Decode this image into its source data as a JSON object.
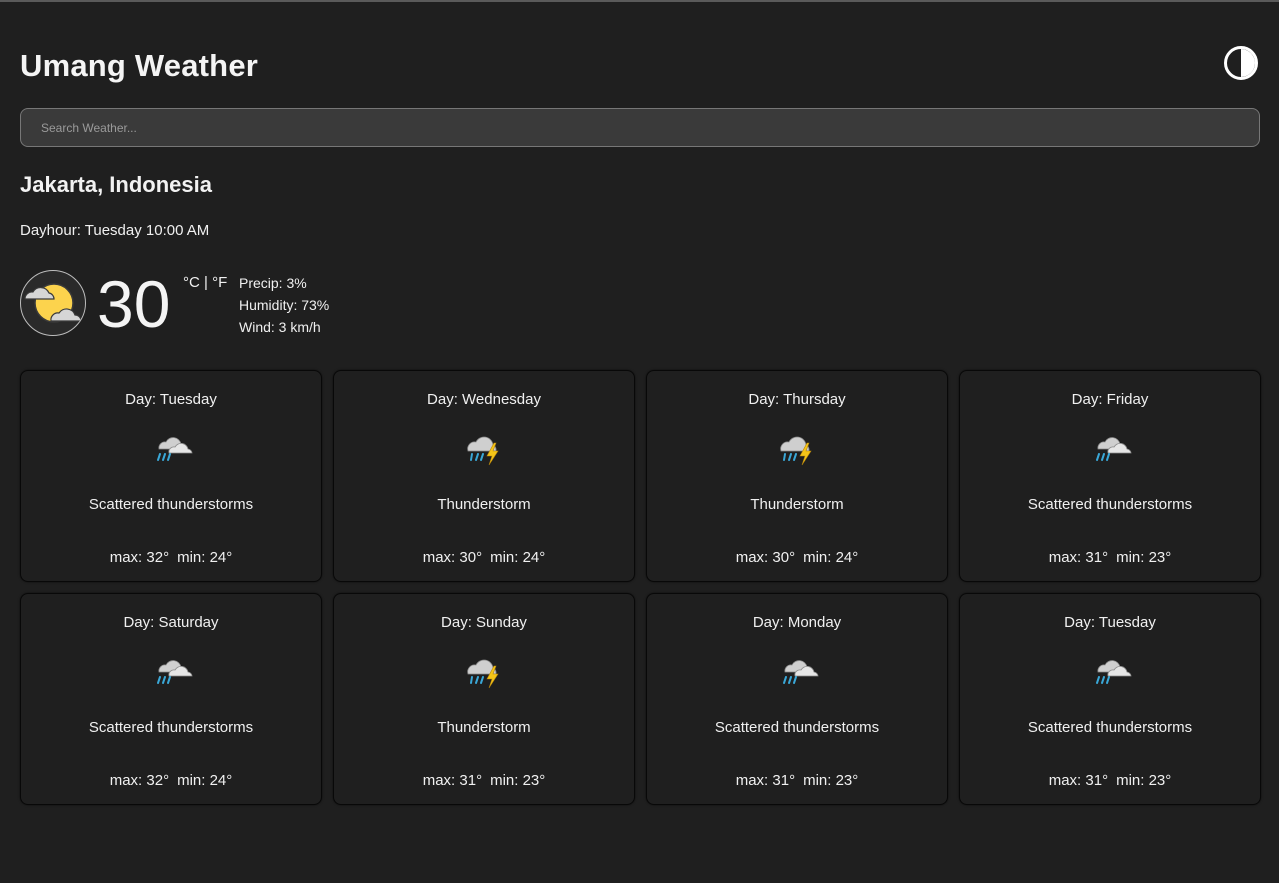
{
  "app": {
    "title": "Umang Weather"
  },
  "search": {
    "placeholder": "Search Weather..."
  },
  "location": "Jakarta, Indonesia",
  "dayhour": "Dayhour: Tuesday 10:00 AM",
  "current": {
    "icon": "partly-cloudy-day-icon",
    "temp": "30",
    "unit_c": "°C",
    "unit_sep": " | ",
    "unit_f": "°F",
    "precip": "Precip: 3%",
    "humidity": "Humidity: 73%",
    "wind": "Wind: 3 km/h"
  },
  "colors": {
    "background": "#1f1f1f",
    "text": "#f0f0f0",
    "sun": "#fcd34d",
    "rain": "#3aa8d8",
    "bolt": "#f5c518",
    "cloud": "#cfcfcf"
  },
  "forecast": [
    {
      "day": "Day: Tuesday",
      "icon": "scattered-thunderstorms-icon",
      "condition": "Scattered thunderstorms",
      "max": "max: 32°",
      "min": "min: 24°"
    },
    {
      "day": "Day: Wednesday",
      "icon": "thunderstorm-icon",
      "condition": "Thunderstorm",
      "max": "max: 30°",
      "min": "min: 24°"
    },
    {
      "day": "Day: Thursday",
      "icon": "thunderstorm-icon",
      "condition": "Thunderstorm",
      "max": "max: 30°",
      "min": "min: 24°"
    },
    {
      "day": "Day: Friday",
      "icon": "scattered-thunderstorms-icon",
      "condition": "Scattered thunderstorms",
      "max": "max: 31°",
      "min": "min: 23°"
    },
    {
      "day": "Day: Saturday",
      "icon": "scattered-thunderstorms-icon",
      "condition": "Scattered thunderstorms",
      "max": "max: 32°",
      "min": "min: 24°"
    },
    {
      "day": "Day: Sunday",
      "icon": "thunderstorm-icon",
      "condition": "Thunderstorm",
      "max": "max: 31°",
      "min": "min: 23°"
    },
    {
      "day": "Day: Monday",
      "icon": "scattered-thunderstorms-icon",
      "condition": "Scattered thunderstorms",
      "max": "max: 31°",
      "min": "min: 23°"
    },
    {
      "day": "Day: Tuesday",
      "icon": "scattered-thunderstorms-icon",
      "condition": "Scattered thunderstorms",
      "max": "max: 31°",
      "min": "min: 23°"
    }
  ]
}
